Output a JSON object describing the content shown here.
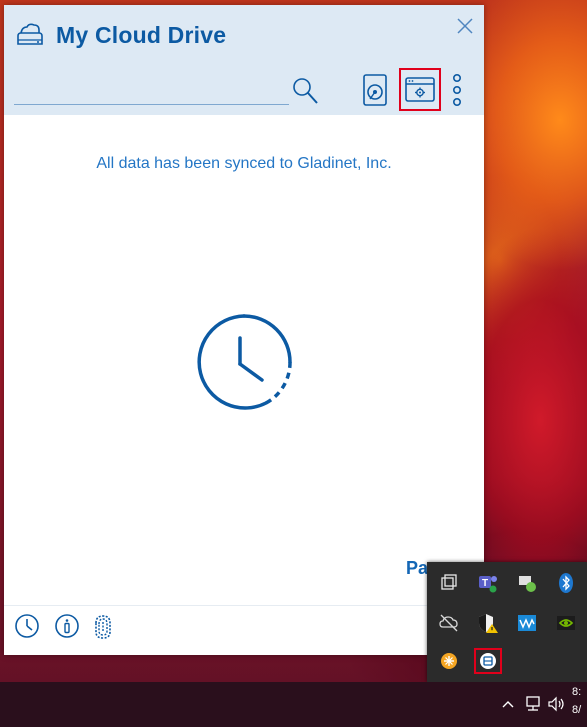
{
  "app": {
    "title": "My Cloud Drive",
    "search": {
      "value": "",
      "placeholder": ""
    },
    "status_message": "All data has been synced to Gladinet, Inc.",
    "pause_label": "Pa"
  },
  "colors": {
    "accent": "#0C5AA3",
    "header_bg": "#DDE9F4",
    "highlight_border": "#E0001B",
    "taskbar_bg": "#2A0F1C",
    "tray_bg": "#2B2B2B"
  },
  "icons": {
    "header": [
      "cloud-drive-icon",
      "close-icon",
      "search-icon",
      "drive-icon",
      "settings-window-icon",
      "more-icon"
    ],
    "footer": [
      "history-clock-icon",
      "info-icon",
      "fingerprint-icon"
    ],
    "tray": [
      "task-view-icon",
      "teams-icon",
      "chat-status-icon",
      "bluetooth-icon",
      "cloud-off-icon",
      "security-warning-icon",
      "waves-icon",
      "nvidia-icon",
      "orange-app-icon",
      "cloud-drive-tray-icon"
    ],
    "taskbar": [
      "chevron-up-icon",
      "network-icon",
      "volume-icon"
    ]
  },
  "taskbar": {
    "time": "8:",
    "date": "8/"
  }
}
